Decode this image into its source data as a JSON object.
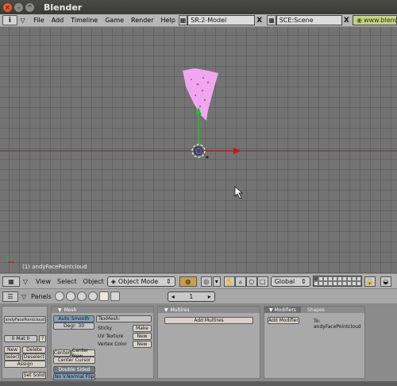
{
  "window": {
    "title": "Blender"
  },
  "menubar": {
    "info_label": "i",
    "items": [
      "File",
      "Add",
      "Timeline",
      "Game",
      "Render",
      "Help"
    ],
    "screen_field": "SR:2-Model",
    "scene_field": "SCE:Scene",
    "close_glyph": "X",
    "url": "www.blend"
  },
  "viewport": {
    "object_label": "(1) andyFacePointcloud",
    "colors": {
      "pointcloud": "#f2a6f2",
      "x_axis": "#d41111",
      "y_axis": "#22c022",
      "grid": "#737373"
    }
  },
  "view_header": {
    "menus": [
      "View",
      "Select",
      "Object"
    ],
    "mode": "Object Mode",
    "orientation": "Global"
  },
  "buttons_header": {
    "panels_label": "Panels",
    "frame_value": "1"
  },
  "panels": {
    "link": {
      "object_name": "andyFacePointcloud",
      "mat_value": "0 Mat 0",
      "mat_q": "?",
      "new": "New",
      "delete": "Delete",
      "select": "Select",
      "deselect": "Deselect",
      "assign": "Assign",
      "set_solid": "Set Solid"
    },
    "mesh": {
      "title": "Mesh",
      "auto_smooth": "Auto Smooth",
      "degr": "Degr: 30",
      "texmesh": "TexMesh:",
      "sticky": "Sticky",
      "uv_texture": "UV Texture",
      "vertex_color": "Vertex Color",
      "make": "Make",
      "new1": "New",
      "new2": "New",
      "center": "Center",
      "center_new": "Center New",
      "center_cursor": "Center Cursor",
      "double_sided": "Double Sided",
      "no_v_normal_flip": "No V.Normal Flip"
    },
    "multires": {
      "title": "Multires",
      "add": "Add Multires"
    },
    "modifiers": {
      "tab1": "Modifiers",
      "tab2": "Shapes",
      "add": "Add Modifier",
      "to": "To: andyFacePointcloud"
    }
  }
}
